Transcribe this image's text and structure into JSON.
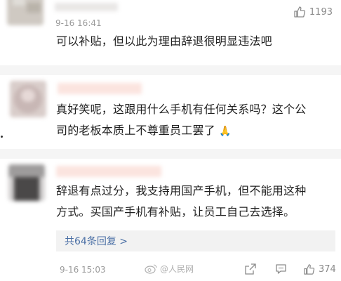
{
  "comments": [
    {
      "timestamp": "9-16 16:41",
      "likes": "1193",
      "text_lines": [
        "可以补贴，但以此为理由辞退很明显违法吧"
      ]
    },
    {
      "text_lines": [
        "真好笑呢，这跟用什么手机有任何关系吗？这个公",
        "司的老板本质上不尊重员工罢了"
      ],
      "emoji": "🙏"
    },
    {
      "timestamp": "9-16 15:03",
      "likes": "374",
      "text_lines": [
        "辞退有点过分，我支持用国产手机，但不能用这种",
        "方式。买国产手机有补贴，让员工自己去选择。"
      ],
      "replies_label": "共64条回复 >",
      "watermark": "@人民网"
    }
  ],
  "colors": {
    "link": "#4a6fa5",
    "meta": "#9a9a9a",
    "name_bar": "#fbe4df"
  },
  "icons": [
    "thumbs-up-icon",
    "share-icon",
    "comment-icon",
    "weibo-logo-icon"
  ]
}
